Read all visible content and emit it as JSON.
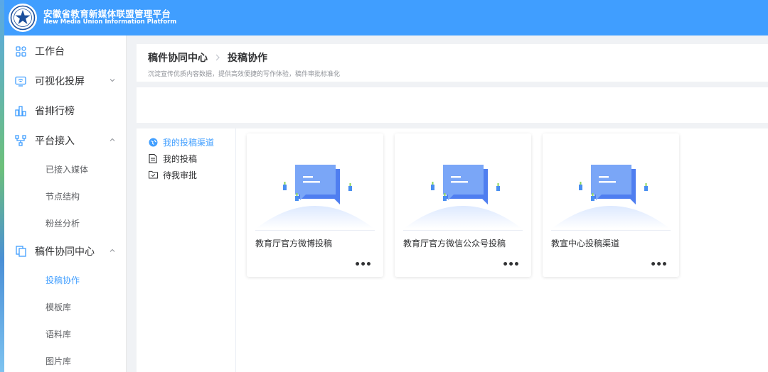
{
  "header": {
    "title_cn": "安徽省教育新媒体联盟管理平台",
    "title_en": "New Media Union Information Platform",
    "brand_color": "#409eff"
  },
  "sidebar": {
    "items": [
      {
        "label": "工作台",
        "icon": "dashboard-icon"
      },
      {
        "label": "可视化投屏",
        "icon": "screen-cast-icon",
        "expandable": true,
        "expanded": false
      },
      {
        "label": "省排行榜",
        "icon": "bar-chart-icon"
      },
      {
        "label": "平台接入",
        "icon": "network-icon",
        "expandable": true,
        "expanded": true,
        "children": [
          "已接入媒体",
          "节点结构",
          "粉丝分析"
        ]
      },
      {
        "label": "稿件协同中心",
        "icon": "documents-icon",
        "expandable": true,
        "expanded": true,
        "children": [
          "投稿协作",
          "模板库",
          "语料库",
          "图片库"
        ],
        "active_child": "投稿协作"
      }
    ]
  },
  "page": {
    "breadcrumb": [
      "稿件协同中心",
      "投稿协作"
    ],
    "description": "沉淀宣传优质内容数据，提供高效便捷的写作体验，稿件审批标准化"
  },
  "tabs": [
    {
      "label": "我的投稿渠道",
      "icon": "globe-icon",
      "active": true
    },
    {
      "label": "我的投稿",
      "icon": "document-icon",
      "active": false
    },
    {
      "label": "待我审批",
      "icon": "folder-check-icon",
      "active": false
    }
  ],
  "cards": [
    {
      "title": "教育厅官方微博投稿",
      "more": "•••"
    },
    {
      "title": "教育厅官方微信公众号投稿",
      "more": "•••"
    },
    {
      "title": "教宣中心投稿渠道",
      "more": "•••"
    }
  ]
}
